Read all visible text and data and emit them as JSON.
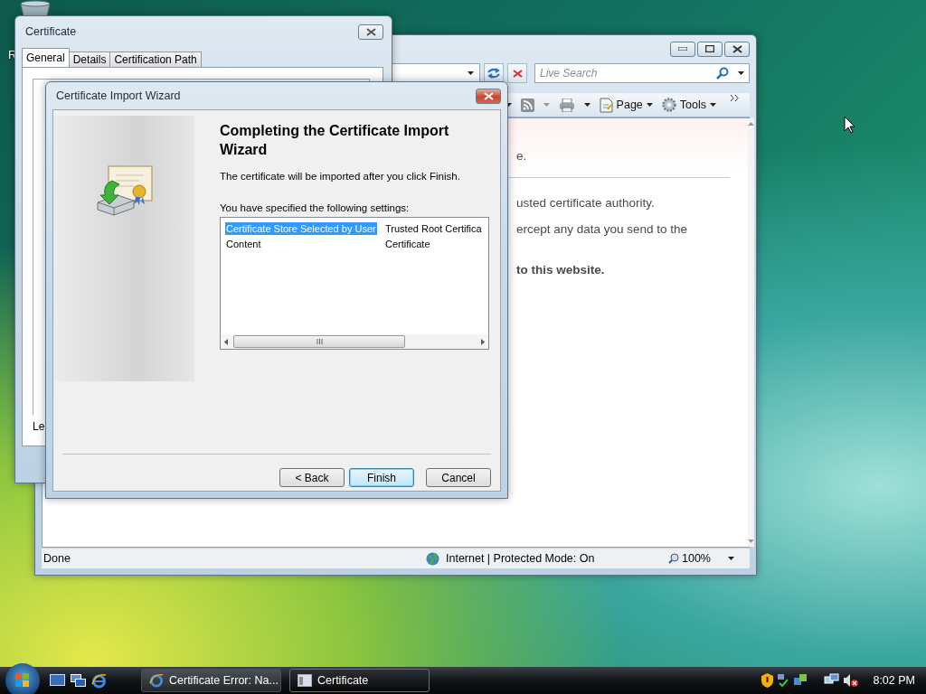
{
  "desktop": {
    "icon_label": "R"
  },
  "browser": {
    "search": {
      "placeholder": "Live Search"
    },
    "command_bar": [
      {
        "kind": "page",
        "label": "Page"
      },
      {
        "kind": "tools",
        "label": "Tools"
      }
    ],
    "content": [
      {
        "kind": "text",
        "text": "e."
      },
      {
        "kind": "rule"
      },
      {
        "kind": "text",
        "text": "usted certificate authority."
      },
      {
        "kind": "text",
        "text": "ercept any data you send to the"
      },
      {
        "kind": "bold",
        "text": "to this website."
      }
    ],
    "status_bar": {
      "status": "Done",
      "zone": "Internet | Protected Mode: On",
      "zoom": "100%"
    }
  },
  "certificate_dialog": {
    "title": "Certificate",
    "tabs": [
      {
        "label": "General",
        "selected": true
      },
      {
        "label": "Details",
        "selected": false
      },
      {
        "label": "Certification Path",
        "selected": false
      }
    ],
    "partial_label": "Le"
  },
  "wizard": {
    "title": "Certificate Import Wizard",
    "heading": "Completing the Certificate Import Wizard",
    "intro": "The certificate will be imported after you click Finish.",
    "settings_label": "You have specified the following settings:",
    "settings": [
      {
        "name": "Certificate Store Selected by User",
        "value": "Trusted Root Certifica",
        "selected": true
      },
      {
        "name": "Content",
        "value": "Certificate",
        "selected": false
      }
    ],
    "buttons": [
      {
        "label": "< Back",
        "default": false
      },
      {
        "label": "Finish",
        "default": true
      },
      {
        "label": "Cancel",
        "default": false
      }
    ]
  },
  "taskbar": {
    "tasks": [
      {
        "kind": "browser",
        "label": "Certificate Error: Na...",
        "active": false
      },
      {
        "kind": "dialog",
        "label": "Certificate",
        "active": true
      }
    ],
    "clock": "8:02 PM"
  }
}
